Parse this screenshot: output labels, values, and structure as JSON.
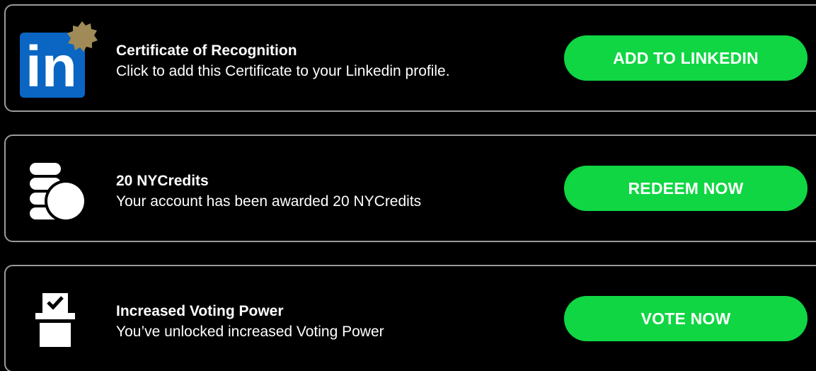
{
  "cards": [
    {
      "icon": "linkedin-certificate-icon",
      "title": "Certificate of Recognition",
      "description": "Click to add this Certificate to your Linkedin profile.",
      "button_label": "ADD TO LINKEDIN",
      "icon_text": "in"
    },
    {
      "icon": "coins-icon",
      "title": "20 NYCredits",
      "description": "Your account has been awarded 20 NYCredits",
      "button_label": "REDEEM NOW"
    },
    {
      "icon": "ballot-box-icon",
      "title": "Increased Voting Power",
      "description": "You’ve unlocked increased Voting Power",
      "button_label": "VOTE NOW"
    }
  ],
  "colors": {
    "background": "#000000",
    "card_border": "#9a9a9a",
    "button_green": "#0fd642",
    "linkedin_blue": "#0a66c2",
    "seal_gold": "#a08a57",
    "text": "#ffffff"
  }
}
